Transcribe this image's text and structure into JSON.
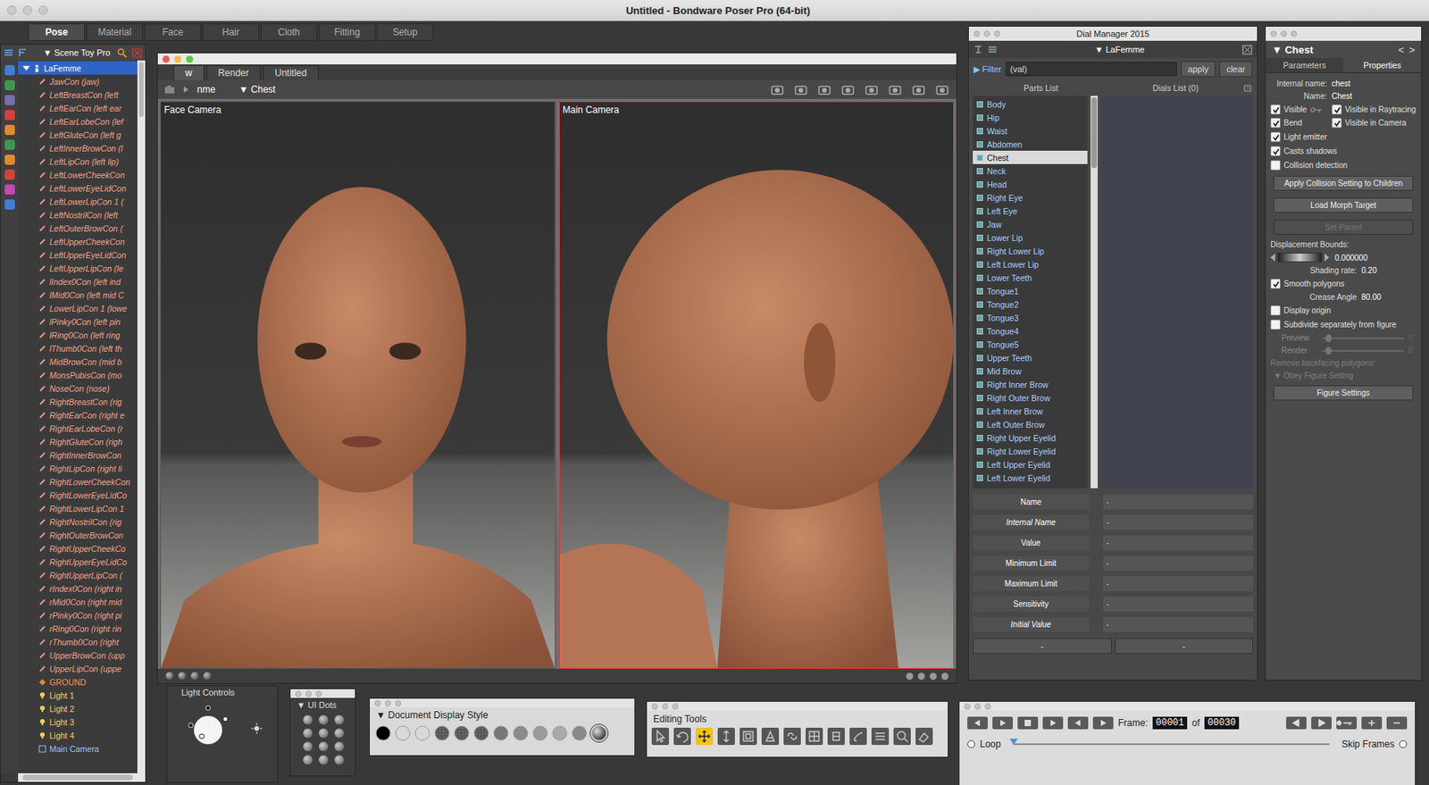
{
  "window": {
    "title": "Untitled - Bondware Poser Pro  (64-bit)"
  },
  "rooms": [
    {
      "label": "Pose",
      "selected": true
    },
    {
      "label": "Material",
      "selected": false
    },
    {
      "label": "Face",
      "selected": false
    },
    {
      "label": "Hair",
      "selected": false
    },
    {
      "label": "Cloth",
      "selected": false
    },
    {
      "label": "Fitting",
      "selected": false
    },
    {
      "label": "Setup",
      "selected": false
    }
  ],
  "scene": {
    "title": "Scene Toy Pro",
    "arrow": "▼",
    "items": [
      {
        "label": "LaFemme",
        "kind": "figure",
        "selected": true,
        "expanded": true
      },
      {
        "label": "JawCon (jaw)",
        "kind": "actor",
        "selected": false
      },
      {
        "label": "LeftBreastCon (left",
        "kind": "actor",
        "selected": false
      },
      {
        "label": "LeftEarCon (left ear",
        "kind": "actor",
        "selected": false
      },
      {
        "label": "LeftEarLobeCon (lef",
        "kind": "actor",
        "selected": false
      },
      {
        "label": "LeftGluteCon (left g",
        "kind": "actor",
        "selected": false
      },
      {
        "label": "LeftInnerBrowCon (l",
        "kind": "actor",
        "selected": false
      },
      {
        "label": "LeftLipCon (left lip)",
        "kind": "actor",
        "selected": false
      },
      {
        "label": "LeftLowerCheekCon",
        "kind": "actor",
        "selected": false
      },
      {
        "label": "LeftLowerEyeLidCon",
        "kind": "actor",
        "selected": false
      },
      {
        "label": "LeftLowerLipCon 1 (",
        "kind": "actor",
        "selected": false
      },
      {
        "label": "LeftNostrilCon (left",
        "kind": "actor",
        "selected": false
      },
      {
        "label": "LeftOuterBrowCon (",
        "kind": "actor",
        "selected": false
      },
      {
        "label": "LeftUpperCheekCon",
        "kind": "actor",
        "selected": false
      },
      {
        "label": "LeftUpperEyeLidCon",
        "kind": "actor",
        "selected": false
      },
      {
        "label": "LeftUpperLipCon (le",
        "kind": "actor",
        "selected": false
      },
      {
        "label": "lIndex0Con (left ind",
        "kind": "actor",
        "selected": false
      },
      {
        "label": "lMid0Con (left mid C",
        "kind": "actor",
        "selected": false
      },
      {
        "label": "LowerLipCon 1 (lowe",
        "kind": "actor",
        "selected": false
      },
      {
        "label": "lPinky0Con (left pin",
        "kind": "actor",
        "selected": false
      },
      {
        "label": "lRing0Con (left ring",
        "kind": "actor",
        "selected": false
      },
      {
        "label": "lThumb0Con (left th",
        "kind": "actor",
        "selected": false
      },
      {
        "label": "MidBrowCon (mid b",
        "kind": "actor",
        "selected": false
      },
      {
        "label": "MonsPubisCon (mo",
        "kind": "actor",
        "selected": false
      },
      {
        "label": "NoseCon (nose)",
        "kind": "actor",
        "selected": false
      },
      {
        "label": "RightBreastCon (rig",
        "kind": "actor",
        "selected": false
      },
      {
        "label": "RightEarCon (right e",
        "kind": "actor",
        "selected": false
      },
      {
        "label": "RightEarLobeCon (r",
        "kind": "actor",
        "selected": false
      },
      {
        "label": "RightGluteCon (righ",
        "kind": "actor",
        "selected": false
      },
      {
        "label": "RightInnerBrowCon",
        "kind": "actor",
        "selected": false
      },
      {
        "label": "RightLipCon (right li",
        "kind": "actor",
        "selected": false
      },
      {
        "label": "RightLowerCheekCon",
        "kind": "actor",
        "selected": false
      },
      {
        "label": "RightLowerEyeLidCo",
        "kind": "actor",
        "selected": false
      },
      {
        "label": "RightLowerLipCon 1",
        "kind": "actor",
        "selected": false
      },
      {
        "label": "RightNostrilCon (rig",
        "kind": "actor",
        "selected": false
      },
      {
        "label": "RightOuterBrowCon",
        "kind": "actor",
        "selected": false
      },
      {
        "label": "RightUpperCheekCo",
        "kind": "actor",
        "selected": false
      },
      {
        "label": "RightUpperEyeLidCo",
        "kind": "actor",
        "selected": false
      },
      {
        "label": "RightUpperLipCon (",
        "kind": "actor",
        "selected": false
      },
      {
        "label": "rIndex0Con (right in",
        "kind": "actor",
        "selected": false
      },
      {
        "label": "rMid0Con (right mid",
        "kind": "actor",
        "selected": false
      },
      {
        "label": "rPinky0Con (right pi",
        "kind": "actor",
        "selected": false
      },
      {
        "label": "rRing0Con (right rin",
        "kind": "actor",
        "selected": false
      },
      {
        "label": "rThumb0Con (right",
        "kind": "actor",
        "selected": false
      },
      {
        "label": "UpperBrowCon (upp",
        "kind": "actor",
        "selected": false
      },
      {
        "label": "UpperLipCon (uppe",
        "kind": "actor",
        "selected": false
      },
      {
        "label": "GROUND",
        "kind": "ground",
        "selected": false
      },
      {
        "label": "Light 1",
        "kind": "light",
        "selected": false
      },
      {
        "label": "Light 2",
        "kind": "light",
        "selected": false
      },
      {
        "label": "Light 3",
        "kind": "light",
        "selected": false
      },
      {
        "label": "Light 4",
        "kind": "light",
        "selected": false
      },
      {
        "label": "Main Camera",
        "kind": "camera",
        "selected": false
      }
    ]
  },
  "document": {
    "tabs": [
      {
        "label": "w",
        "selected": true
      },
      {
        "label": "Render",
        "selected": false
      },
      {
        "label": "Untitled",
        "selected": false
      }
    ],
    "figure": "nme",
    "actor_arrow": "▼",
    "actor": "Chest",
    "viewports": [
      {
        "label": "Face Camera",
        "selected": false
      },
      {
        "label": "Main Camera",
        "selected": true
      }
    ]
  },
  "dial_manager": {
    "title": "Dial Manager 2015",
    "figure_arrow": "▼",
    "figure": "LaFemme",
    "filter_arrow": "▶",
    "filter_label": "Filter",
    "filter_value": "(val)",
    "apply": "apply",
    "clear": "clear",
    "parts_header": "Parts List",
    "dials_header": "Dials List (0)",
    "parts": [
      {
        "label": "Body",
        "selected": false
      },
      {
        "label": "Hip",
        "selected": false
      },
      {
        "label": "Waist",
        "selected": false
      },
      {
        "label": "Abdomen",
        "selected": false
      },
      {
        "label": "Chest",
        "selected": true
      },
      {
        "label": "Neck",
        "selected": false
      },
      {
        "label": "Head",
        "selected": false
      },
      {
        "label": "Right Eye",
        "selected": false
      },
      {
        "label": "Left Eye",
        "selected": false
      },
      {
        "label": "Jaw",
        "selected": false
      },
      {
        "label": "Lower Lip",
        "selected": false
      },
      {
        "label": "Right Lower Lip",
        "selected": false
      },
      {
        "label": "Left Lower Lip",
        "selected": false
      },
      {
        "label": "Lower Teeth",
        "selected": false
      },
      {
        "label": "Tongue1",
        "selected": false
      },
      {
        "label": "Tongue2",
        "selected": false
      },
      {
        "label": "Tongue3",
        "selected": false
      },
      {
        "label": "Tongue4",
        "selected": false
      },
      {
        "label": "Tongue5",
        "selected": false
      },
      {
        "label": "Upper Teeth",
        "selected": false
      },
      {
        "label": "Mid Brow",
        "selected": false
      },
      {
        "label": "Right Inner Brow",
        "selected": false
      },
      {
        "label": "Right Outer Brow",
        "selected": false
      },
      {
        "label": "Left Inner Brow",
        "selected": false
      },
      {
        "label": "Left Outer Brow",
        "selected": false
      },
      {
        "label": "Right Upper Eyelid",
        "selected": false
      },
      {
        "label": "Right Lower Eyelid",
        "selected": false
      },
      {
        "label": "Left Upper Eyelid",
        "selected": false
      },
      {
        "label": "Left Lower Eyelid",
        "selected": false
      }
    ],
    "fields": [
      {
        "label": "Name",
        "value": "-",
        "italic": false
      },
      {
        "label": "Internal Name",
        "value": "-",
        "italic": true
      },
      {
        "label": "Value",
        "value": "-",
        "italic": false
      },
      {
        "label": "Minimum Limit",
        "value": "-",
        "italic": false
      },
      {
        "label": "Maximum Limit",
        "value": "-",
        "italic": false
      },
      {
        "label": "Sensitivity",
        "value": "-",
        "italic": false
      },
      {
        "label": "Initial Value",
        "value": "-",
        "italic": true
      }
    ],
    "footer_buttons": [
      "-",
      "-"
    ]
  },
  "properties": {
    "arrow": "▼",
    "title": "Chest",
    "prev": "<",
    "next": ">",
    "tabs": [
      {
        "label": "Parameters",
        "selected": false
      },
      {
        "label": "Properties",
        "selected": true
      }
    ],
    "internal_name_label": "Internal name:",
    "internal_name": "chest",
    "name_label": "Name:",
    "name": "Chest",
    "check_grid": [
      {
        "label": "Visible",
        "checked": true
      },
      {
        "label": "Visible in Raytracing",
        "checked": true
      },
      {
        "label": "Bend",
        "checked": true
      },
      {
        "label": "Visible in Camera",
        "checked": true
      }
    ],
    "checks": [
      {
        "label": "Light emitter",
        "checked": true
      },
      {
        "label": "Casts shadows",
        "checked": true
      },
      {
        "label": "Collision detection",
        "checked": false
      }
    ],
    "buttons": [
      {
        "label": "Apply Collision Setting to Children",
        "disabled": false
      },
      {
        "label": "Load Morph Target",
        "disabled": false
      },
      {
        "label": "Set Parent",
        "disabled": true
      }
    ],
    "displacement": {
      "label": "Displacement Bounds:",
      "value": "0.000000",
      "level": 0
    },
    "shading": {
      "label": "Shading rate:",
      "value": "0.20"
    },
    "smooth": {
      "label": "Smooth polygons",
      "checked": true
    },
    "crease": {
      "label": "Crease Angle",
      "value": "80.00"
    },
    "display_origin": {
      "label": "Display origin",
      "checked": false
    },
    "subdivide": {
      "label": "Subdivide separately from figure",
      "checked": false
    },
    "subdiv_sliders": [
      {
        "label": "Preview",
        "value": "0",
        "level": 0,
        "disabled": true
      },
      {
        "label": "Render",
        "value": "0",
        "level": 0,
        "disabled": true
      }
    ],
    "backfacing": {
      "label": "Remove backfacing polygons:",
      "disabled": true
    },
    "backfacing_menu": {
      "arrow": "▼",
      "label": "Obey Figure Setting",
      "disabled": true
    },
    "figure_settings": "Figure Settings"
  },
  "light_controls": {
    "title": "Light Controls"
  },
  "ui_dots": {
    "arrow": "▼",
    "title": "UI Dots"
  },
  "display_style": {
    "arrow": "▼",
    "title": "Document Display Style",
    "styles": [
      {
        "selected": false
      },
      {
        "selected": false
      },
      {
        "selected": false
      },
      {
        "selected": false
      },
      {
        "selected": false
      },
      {
        "selected": false
      },
      {
        "selected": false
      },
      {
        "selected": false
      },
      {
        "selected": false
      },
      {
        "selected": false
      },
      {
        "selected": false
      },
      {
        "selected": true
      }
    ]
  },
  "editing_tools": {
    "title": "Editing Tools",
    "tools": [
      {
        "selected": false
      },
      {
        "selected": false
      },
      {
        "selected": true
      },
      {
        "selected": false
      },
      {
        "selected": false
      },
      {
        "selected": false
      },
      {
        "selected": false
      },
      {
        "selected": false
      },
      {
        "selected": false
      },
      {
        "selected": false
      },
      {
        "selected": false
      },
      {
        "selected": false
      },
      {
        "selected": false
      }
    ]
  },
  "animation": {
    "frame_label": "Frame:",
    "frame": "00001",
    "of": "of",
    "total": "00030",
    "loop": {
      "label": "Loop",
      "on": false
    },
    "skip": {
      "label": "Skip Frames",
      "on": false
    },
    "level": 0
  }
}
